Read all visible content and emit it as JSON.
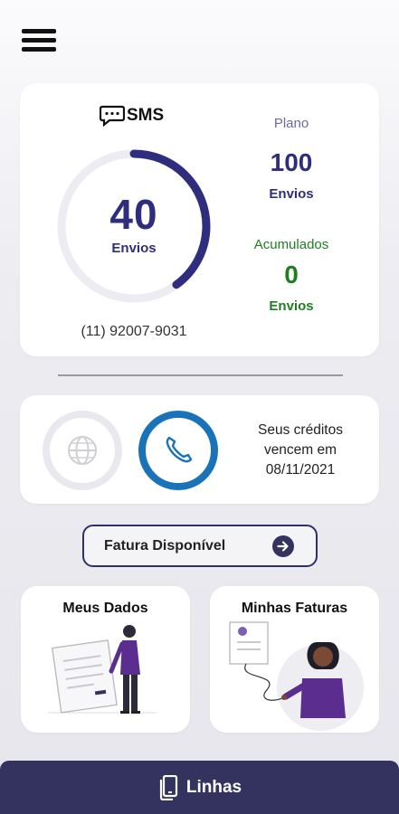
{
  "header": {
    "menu_icon": "hamburger-menu-icon"
  },
  "sms_card": {
    "title": "SMS",
    "title_icon": "chat-bubble-icon",
    "used_value": "40",
    "used_unit": "Envios",
    "usage_fraction": 0.4,
    "phone_number": "(11) 92007-9031",
    "plan_label": "Plano",
    "plan_value": "100",
    "plan_unit": "Envios",
    "accumulated_label": "Acumulados",
    "accumulated_value": "0",
    "accumulated_unit": "Envios"
  },
  "credits_card": {
    "globe_icon": "globe-icon",
    "phone_icon": "phone-icon",
    "expiry_line1": "Seus créditos",
    "expiry_line2": "vencem em",
    "expiry_date": "08/11/2021"
  },
  "invoice_button": {
    "label": "Fatura Disponível",
    "icon": "arrow-right-circle-icon"
  },
  "tiles": {
    "dados": {
      "title": "Meus Dados"
    },
    "faturas": {
      "title": "Minhas Faturas"
    }
  },
  "bottom_bar": {
    "label": "Linhas",
    "icon": "phone-stack-icon"
  },
  "colors": {
    "primary": "#2f2e7e",
    "accent_blue": "#1a73b8",
    "green": "#1e7f21",
    "bar_bg": "#34335f"
  }
}
